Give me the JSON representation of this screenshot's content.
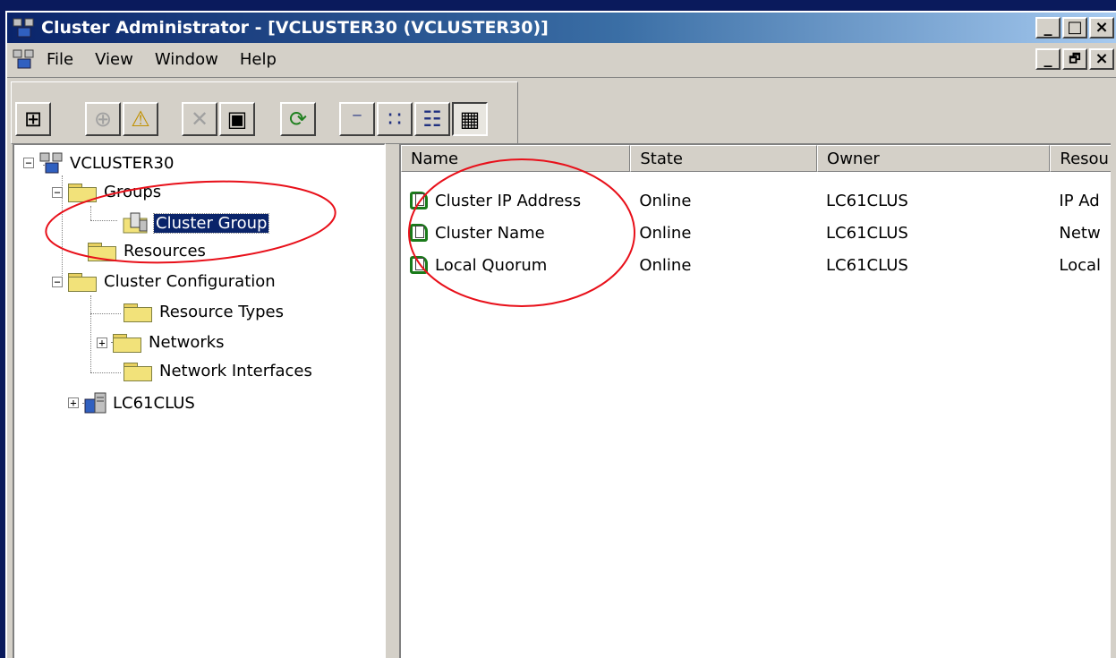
{
  "window": {
    "title": "Cluster Administrator - [VCLUSTER30 (VCLUSTER30)]",
    "min_glyph": "_",
    "max_glyph": "□",
    "close_glyph": "×",
    "restore_glyph": "🗗"
  },
  "menubar": {
    "items": [
      "File",
      "View",
      "Window",
      "Help"
    ]
  },
  "toolbar": {
    "buttons": [
      {
        "icon": "cluster-icon",
        "glyph": "⊞"
      },
      {
        "icon": "bring-online-icon",
        "glyph": "⊕"
      },
      {
        "icon": "take-offline-icon",
        "glyph": "⚠"
      },
      {
        "icon": "delete-icon",
        "glyph": "✕"
      },
      {
        "icon": "properties-icon",
        "glyph": "▣"
      },
      {
        "icon": "refresh-icon",
        "glyph": "⟳"
      },
      {
        "icon": "large-icons-icon",
        "glyph": "⁻"
      },
      {
        "icon": "small-icons-icon",
        "glyph": "∷"
      },
      {
        "icon": "list-view-icon",
        "glyph": "☷"
      },
      {
        "icon": "details-view-icon",
        "glyph": "▦"
      }
    ]
  },
  "tree": {
    "root": "VCLUSTER30",
    "groups": "Groups",
    "cluster_group": "Cluster Group",
    "resources": "Resources",
    "cluster_configuration": "Cluster Configuration",
    "resource_types": "Resource Types",
    "networks": "Networks",
    "network_interfaces": "Network Interfaces",
    "node": "LC61CLUS",
    "collapse_glyph": "−",
    "expand_glyph": "+"
  },
  "list": {
    "columns": [
      "Name",
      "State",
      "Owner",
      "Resou"
    ],
    "rows": [
      {
        "name": "Cluster IP Address",
        "state": "Online",
        "owner": "LC61CLUS",
        "type": "IP Ad"
      },
      {
        "name": "Cluster Name",
        "state": "Online",
        "owner": "LC61CLUS",
        "type": "Netw"
      },
      {
        "name": "Local Quorum",
        "state": "Online",
        "owner": "LC61CLUS",
        "type": "Local"
      }
    ]
  },
  "colors": {
    "desktop": "#0a1a5c",
    "title_start": "#0a246a",
    "title_end": "#a6caf0",
    "annotation": "#e8101a",
    "selection": "#0a246a"
  }
}
